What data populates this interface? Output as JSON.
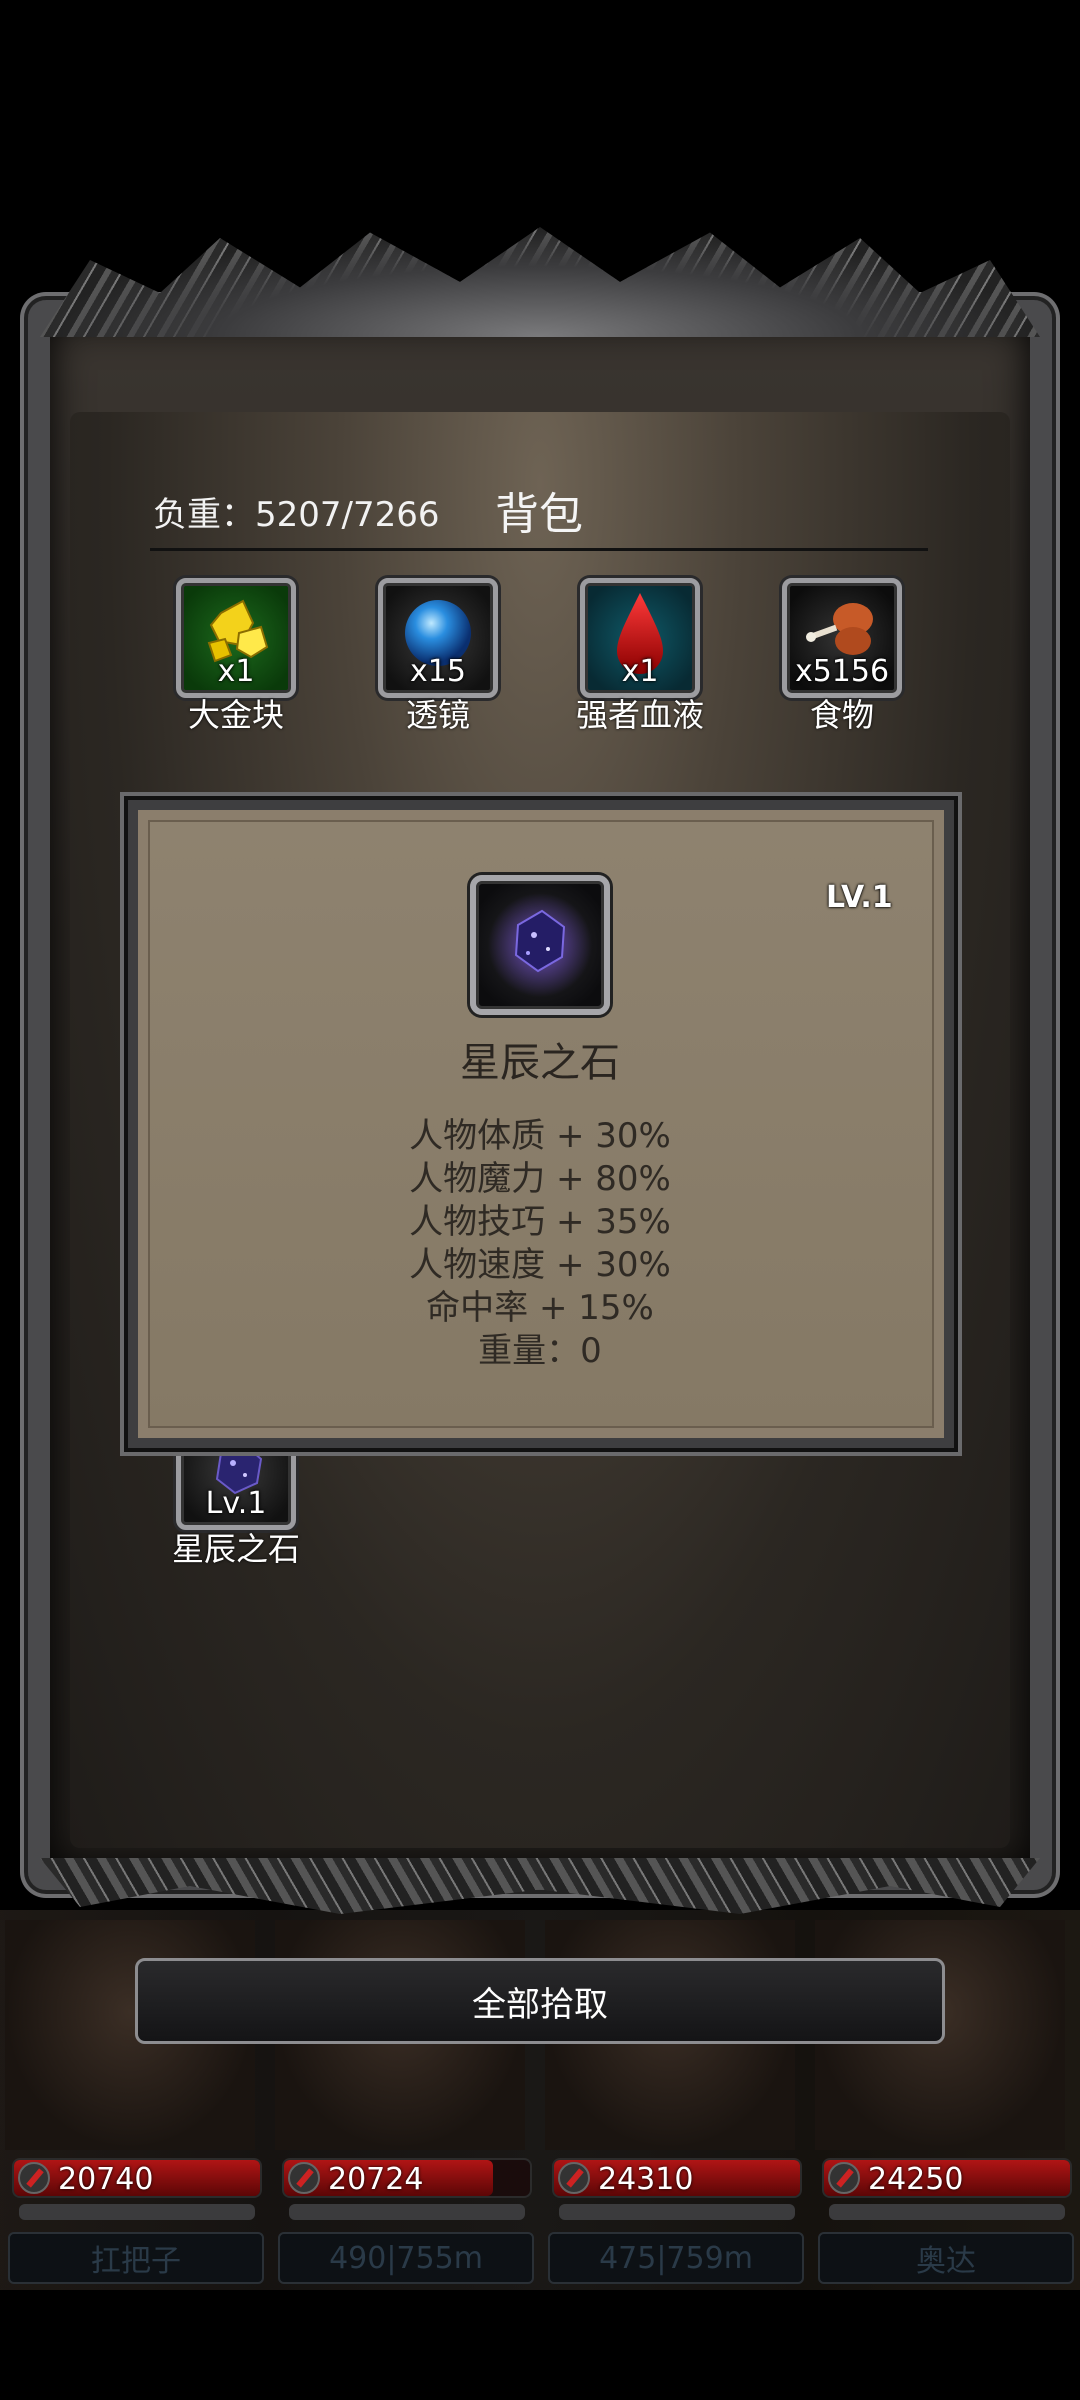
{
  "bag": {
    "weight": "负重：5207/7266",
    "title": "背包"
  },
  "items": [
    {
      "name": "大金块",
      "qty": "x1",
      "icon": "gold-nugget-icon"
    },
    {
      "name": "透镜",
      "qty": "x15",
      "icon": "blue-orb-icon"
    },
    {
      "name": "强者血液",
      "qty": "x1",
      "icon": "blood-drop-icon"
    },
    {
      "name": "食物",
      "qty": "x5156",
      "icon": "meat-icon"
    }
  ],
  "star_stone_slot": {
    "level": "Lv.1",
    "name": "星辰之石",
    "icon": "star-stone-icon"
  },
  "popup": {
    "level": "LV.1",
    "name": "星辰之石",
    "stats": [
      "人物体质 + 30%",
      "人物魔力 + 80%",
      "人物技巧 + 35%",
      "人物速度 + 30%",
      "命中率 + 15%",
      "重量：0"
    ]
  },
  "pickup_button": "全部拾取",
  "heroes": [
    {
      "hp": "20740",
      "hp_fill": 1.0,
      "name": "扛把子"
    },
    {
      "hp": "20724",
      "hp_fill": 0.85,
      "name": "490|755m"
    },
    {
      "hp": "24310",
      "hp_fill": 1.0,
      "name": "475|759m"
    },
    {
      "hp": "24250",
      "hp_fill": 1.0,
      "name": "奥达"
    }
  ]
}
